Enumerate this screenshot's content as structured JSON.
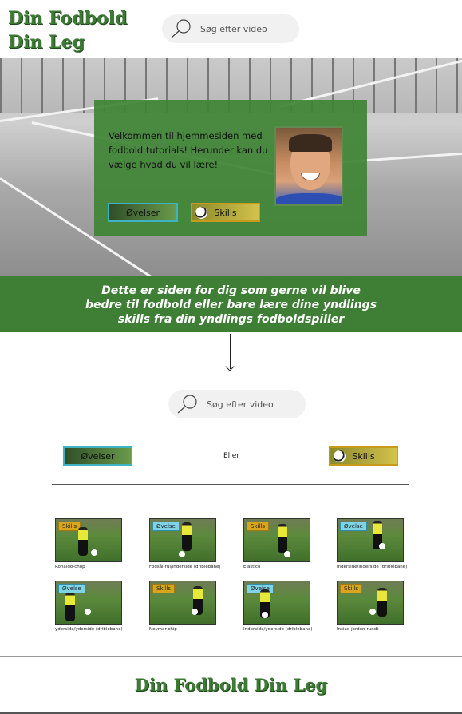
{
  "header": {
    "logo_line1": "Din Fodbold",
    "logo_line2": "Din Leg",
    "search_placeholder": "Søg efter video"
  },
  "hero": {
    "welcome_text": "Velkommen til hjemmesiden med fodbold tutorials! Herunder kan du vælge hvad du vil lære!",
    "button_ovelser": "Øvelser",
    "button_skills": "Skills"
  },
  "banner": {
    "line1": "Dette er siden for dig som gerne vil blive",
    "line2": "bedre til fodbold eller bare lære dine yndlings",
    "line3": "skills fra din yndlings fodboldspiller"
  },
  "section": {
    "search_placeholder": "Søg efter video",
    "button_ovelser": "Øvelser",
    "or_text": "Eller",
    "button_skills": "Skills"
  },
  "videos": [
    {
      "tag": "Skills",
      "caption": "Ronaldo-chop"
    },
    {
      "tag": "Øvelse",
      "caption": "Fodsål-rul/inderside (driblebane)"
    },
    {
      "tag": "Skills",
      "caption": "Elastico"
    },
    {
      "tag": "Øvelse",
      "caption": "Inderside/inderside (driblebane)"
    },
    {
      "tag": "Øvelse",
      "caption": "yderside/yderside (driblebane)"
    },
    {
      "tag": "Skills",
      "caption": "Neymar-chip"
    },
    {
      "tag": "Øvelse",
      "caption": "Inderside/yderside (driblebane)"
    },
    {
      "tag": "Skills",
      "caption": "Insiad jorden-rundt"
    }
  ],
  "footer": {
    "title": "Din Fodbold Din Leg"
  },
  "colors": {
    "brand_green": "#3e7e35",
    "skills_gold": "#d8a51c",
    "ovelse_cyan": "#7fd3e6"
  }
}
